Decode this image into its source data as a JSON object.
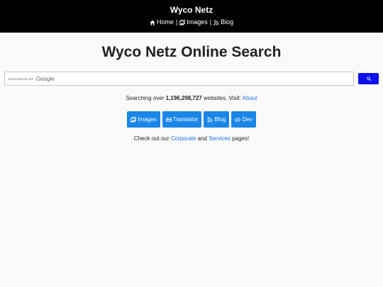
{
  "header": {
    "site_title": "Wyco Netz",
    "nav": [
      {
        "label": "Home",
        "icon": "home-icon"
      },
      {
        "label": "Images",
        "icon": "images-icon"
      },
      {
        "label": "Blog",
        "icon": "rss-icon"
      }
    ],
    "separator": "|"
  },
  "main": {
    "title": "Wyco Netz Online Search",
    "search": {
      "enhanced_by": "ENHANCED BY",
      "google": "Google",
      "value": "",
      "button_icon": "search-icon",
      "button_color": "#0d10ec"
    },
    "stats": {
      "prefix": "Searching over",
      "count": "1,196,298,727",
      "suffix": "websites. Visit:",
      "link": "About"
    },
    "buttons": [
      {
        "label": "Images",
        "icon": "images-icon"
      },
      {
        "label": "Translator",
        "icon": "translator-icon"
      },
      {
        "label": "Blog",
        "icon": "rss-icon"
      },
      {
        "label": "Dev",
        "icon": "code-icon"
      }
    ],
    "button_color": "#1a86e8",
    "corporate": {
      "prefix": "Check out our",
      "link1": "Corporate",
      "mid": "and",
      "link2": "Services",
      "suffix": "pages!"
    }
  }
}
